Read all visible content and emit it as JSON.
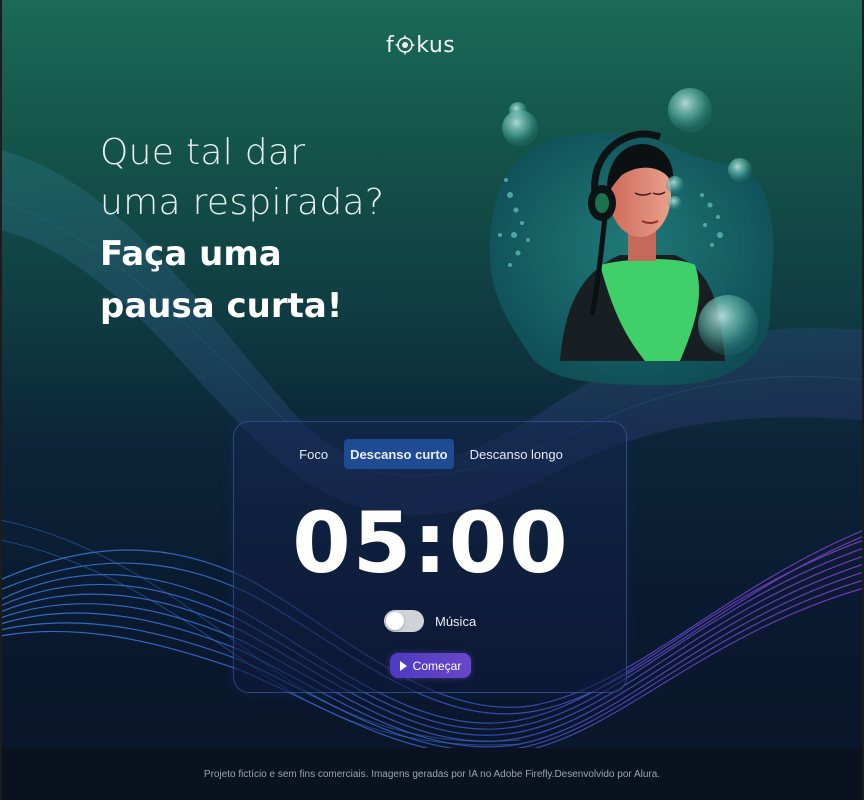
{
  "logo": {
    "text_prefix": "f",
    "text_suffix": "kus",
    "icon": "target-o-icon"
  },
  "hero": {
    "line1": "Que tal dar",
    "line2": "uma respirada?",
    "strong1": "Faça uma",
    "strong2": "pausa curta!"
  },
  "tabs": [
    {
      "label": "Foco",
      "active": false
    },
    {
      "label": "Descanso curto",
      "active": true
    },
    {
      "label": "Descanso longo",
      "active": false
    }
  ],
  "timer": {
    "display": "05:00"
  },
  "music": {
    "label": "Música",
    "enabled": false
  },
  "start_button": {
    "label": "Começar",
    "icon": "play-icon"
  },
  "footer": {
    "text": "Projeto fictício e sem fins comerciais. Imagens geradas por IA no Adobe Firefly.Desenvolvido por Alura."
  },
  "colors": {
    "active_tab": "#1f4b92",
    "button_gradient_start": "#4b3bc0",
    "button_gradient_end": "#6a47c8",
    "accent_green": "#3fd06a"
  }
}
